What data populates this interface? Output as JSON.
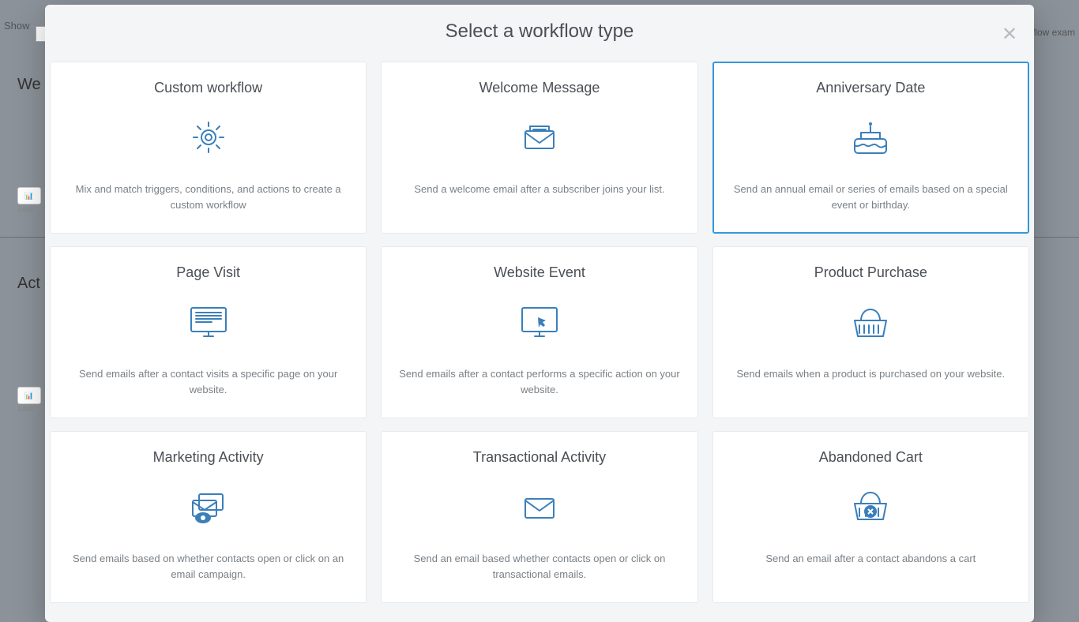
{
  "bg": {
    "show_label": "Show",
    "link_right": "flow exam",
    "heading1": "We",
    "heading2": "Act",
    "chip_label": "",
    "chip_sub": "Last"
  },
  "modal": {
    "title": "Select a workflow type"
  },
  "cards": [
    {
      "title": "Custom workflow",
      "desc": "Mix and match triggers, conditions, and actions to create a custom workflow",
      "selected": false,
      "icon": "gear"
    },
    {
      "title": "Welcome Message",
      "desc": "Send a welcome email after a subscriber joins your list.",
      "selected": false,
      "icon": "envelope"
    },
    {
      "title": "Anniversary Date",
      "desc": "Send an annual email or series of emails based on a special event or birthday.",
      "selected": true,
      "icon": "cake"
    },
    {
      "title": "Page Visit",
      "desc": "Send emails after a contact visits a specific page on your website.",
      "selected": false,
      "icon": "monitor-page"
    },
    {
      "title": "Website Event",
      "desc": "Send emails after a contact performs a specific action on your website.",
      "selected": false,
      "icon": "monitor-click"
    },
    {
      "title": "Product Purchase",
      "desc": "Send emails when a product is purchased on your website.",
      "selected": false,
      "icon": "basket"
    },
    {
      "title": "Marketing Activity",
      "desc": "Send emails based on whether contacts open or click on an email campaign.",
      "selected": false,
      "icon": "mail-eye"
    },
    {
      "title": "Transactional Activity",
      "desc": "Send an email based whether contacts open or click on transactional emails.",
      "selected": false,
      "icon": "mail-plain"
    },
    {
      "title": "Abandoned Cart",
      "desc": "Send an email after a contact abandons a cart",
      "selected": false,
      "icon": "basket-x"
    }
  ]
}
